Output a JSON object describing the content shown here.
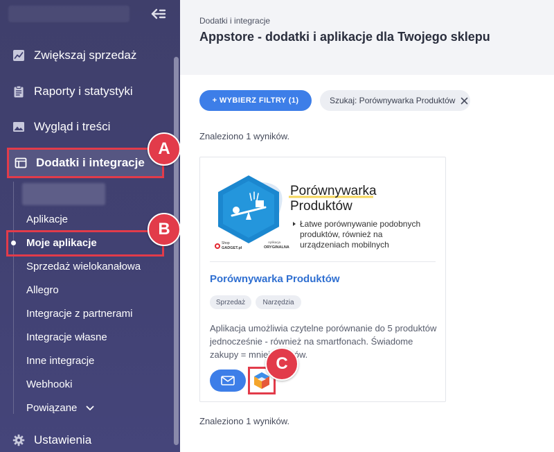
{
  "sidebar": {
    "nav": [
      {
        "label": "Zwiększaj sprzedaż",
        "icon": "chart-line-icon"
      },
      {
        "label": "Raporty i statystyki",
        "icon": "clipboard-icon"
      },
      {
        "label": "Wygląd i treści",
        "icon": "image-icon"
      },
      {
        "label": "Dodatki i integracje",
        "icon": "window-icon",
        "active": true
      }
    ],
    "sub_items": [
      {
        "label": "Aplikacje"
      },
      {
        "label": "Moje aplikacje",
        "active": true
      },
      {
        "label": "Sprzedaż wielokanałowa"
      },
      {
        "label": "Allegro"
      },
      {
        "label": "Integracje z partnerami"
      },
      {
        "label": "Integracje własne"
      },
      {
        "label": "Inne integracje"
      },
      {
        "label": "Webhooki"
      },
      {
        "label": "Powiązane"
      }
    ],
    "settings": {
      "label": "Ustawienia",
      "icon": "gear-icon"
    }
  },
  "annotations": {
    "a": "A",
    "b": "B",
    "c": "C"
  },
  "header": {
    "breadcrumb": "Dodatki i integracje",
    "title": "Appstore - dodatki i aplikacje dla Twojego sklepu"
  },
  "filters": {
    "button_label": "+ WYBIERZ FILTRY (1)",
    "search_chip": "Szukaj: Porównywarka Produktów"
  },
  "results": {
    "count_text": "Znaleziono 1 wyników."
  },
  "card": {
    "image": {
      "heading_line1": "Porównywarka",
      "heading_line2": "Produktów",
      "bullet_line1": "Łatwe porównywanie podobnych",
      "bullet_line2": "produktów, również na",
      "bullet_line3": "urządzeniach mobilnych",
      "logo_small": "Shop",
      "logo_brand": "GADGET.pl",
      "badge_small": "Aplikacja",
      "badge_text": "ORYGINALNA"
    },
    "title": "Porównywarka Produktów",
    "tags": [
      "Sprzedaż",
      "Narzędzia"
    ],
    "description": "Aplikacja umożliwia czytelne porównanie do 5 produktów jednocześnie - również na smartfonach. Świadome zakupy = mniej zwrotów."
  },
  "colors": {
    "sidebar_bg": "#414172",
    "accent_blue": "#3d7ee8",
    "highlight_red": "#e23b4a"
  }
}
